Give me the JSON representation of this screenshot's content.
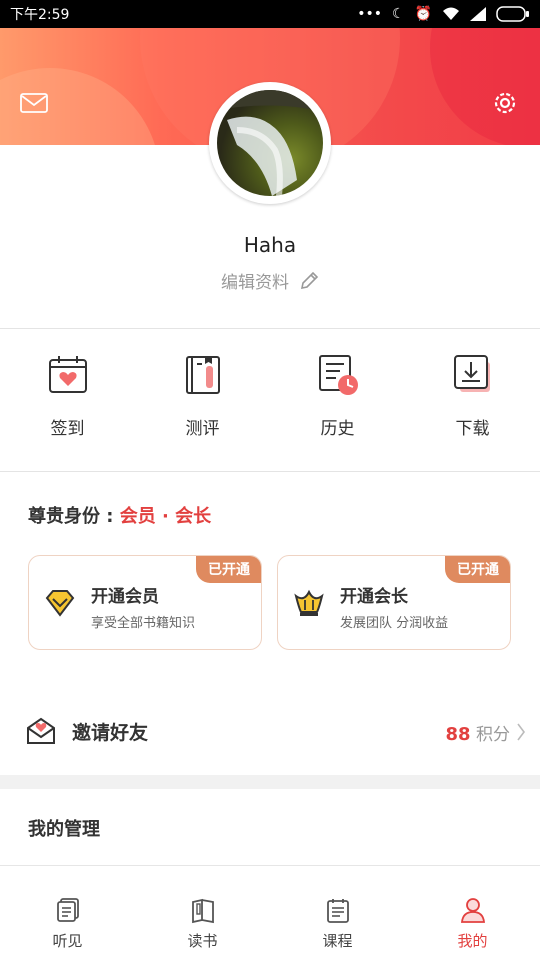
{
  "status_bar": {
    "time": "下午2:59"
  },
  "profile": {
    "username": "Haha",
    "edit_label": "编辑资料"
  },
  "quick_actions": [
    {
      "label": "签到",
      "icon": "calendar-heart-icon"
    },
    {
      "label": "测评",
      "icon": "book-bookmark-icon"
    },
    {
      "label": "历史",
      "icon": "history-clock-icon"
    },
    {
      "label": "下载",
      "icon": "download-icon"
    }
  ],
  "identity": {
    "label": "尊贵身份 : ",
    "value": "会员 · 会长"
  },
  "memberships": [
    {
      "title": "开通会员",
      "desc": "享受全部书籍知识",
      "badge": "已开通",
      "icon": "diamond-icon"
    },
    {
      "title": "开通会长",
      "desc": "发展团队 分润收益",
      "badge": "已开通",
      "icon": "crown-icon"
    }
  ],
  "invite": {
    "label": "邀请好友",
    "points_value": "88",
    "points_unit": "积分"
  },
  "management": {
    "title": "我的管理"
  },
  "tabs": [
    {
      "label": "听见",
      "icon": "listen-icon"
    },
    {
      "label": "读书",
      "icon": "book-icon"
    },
    {
      "label": "课程",
      "icon": "course-icon"
    },
    {
      "label": "我的",
      "icon": "profile-icon",
      "active": true
    }
  ],
  "colors": {
    "accent": "#e2403f",
    "badge": "#df8a5f",
    "hero_start": "#ff9a6b",
    "hero_end": "#f23c47"
  }
}
